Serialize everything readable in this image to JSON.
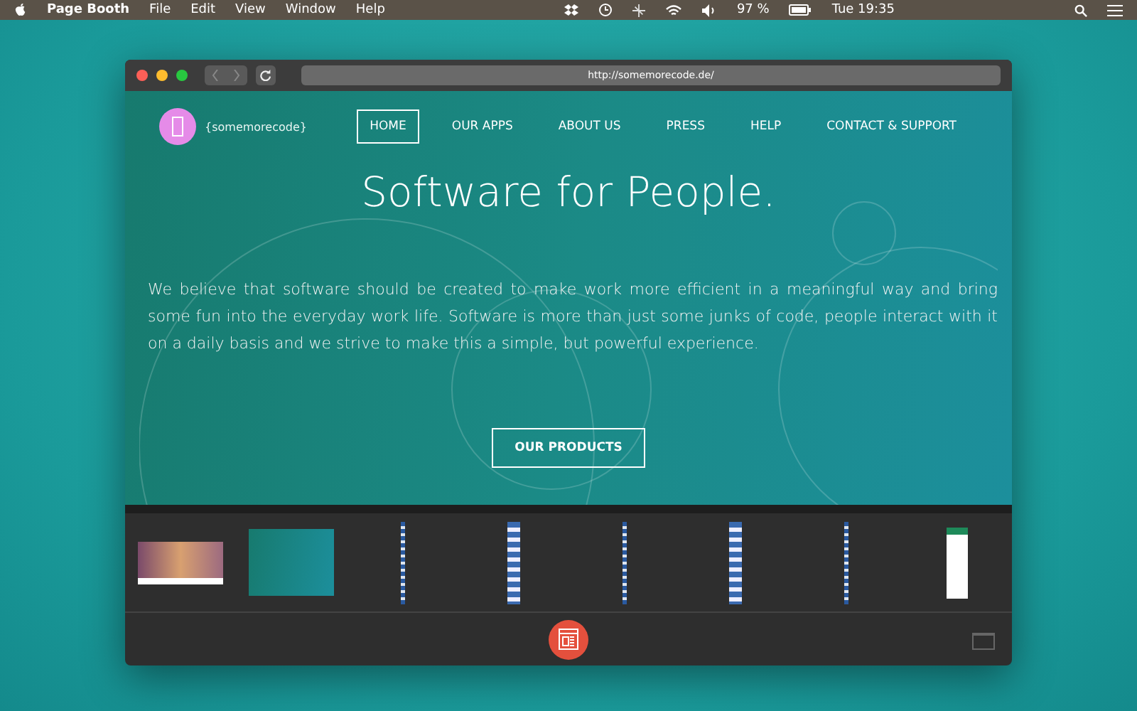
{
  "menubar": {
    "app_name": "Page Booth",
    "menus": [
      "File",
      "Edit",
      "View",
      "Window",
      "Help"
    ],
    "battery": "97 %",
    "clock": "Tue 19:35"
  },
  "browser": {
    "url": "http://somemorecode.de/"
  },
  "site": {
    "logo_text": "{somemorecode}",
    "nav": [
      {
        "label": "HOME",
        "selected": true
      },
      {
        "label": "OUR APPS",
        "selected": false
      },
      {
        "label": "ABOUT US",
        "selected": false
      },
      {
        "label": "PRESS",
        "selected": false
      },
      {
        "label": "HELP",
        "selected": false
      },
      {
        "label": "CONTACT & SUPPORT",
        "selected": false
      }
    ],
    "headline": "Software for People.",
    "intro": "We believe that software should be created to make work more efficient in a meaningful way and bring some fun into the everyday work life. Software is more than just some junks of code, people interact with it on a daily basis and we strive to make this a simple, but powerful experience.",
    "cta": "OUR PRODUCTS"
  },
  "thumbnails": [
    {
      "kind": "photo"
    },
    {
      "kind": "page"
    },
    {
      "kind": "strip"
    },
    {
      "kind": "tall"
    },
    {
      "kind": "strip"
    },
    {
      "kind": "tall"
    },
    {
      "kind": "strip"
    },
    {
      "kind": "phone"
    }
  ]
}
